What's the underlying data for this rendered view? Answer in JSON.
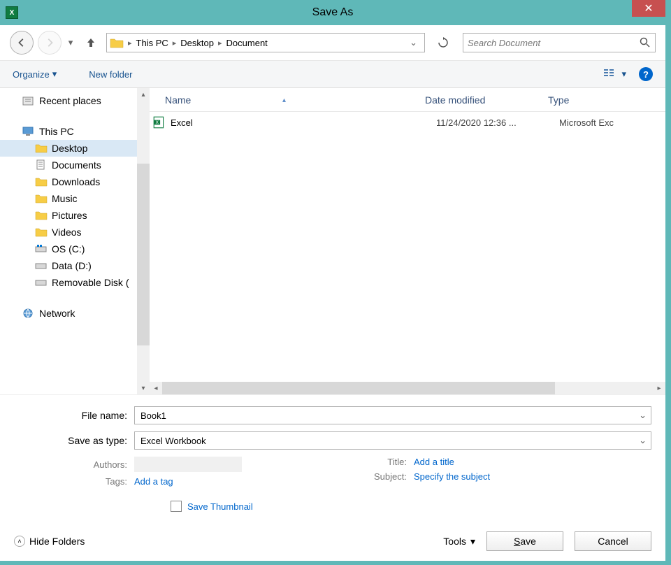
{
  "titlebar": {
    "title": "Save As"
  },
  "breadcrumb": {
    "seg1": "This PC",
    "seg2": "Desktop",
    "seg3": "Document"
  },
  "search": {
    "placeholder": "Search Document"
  },
  "toolbar": {
    "organize": "Organize",
    "new_folder": "New folder"
  },
  "tree": {
    "recent_places": "Recent places",
    "this_pc": "This PC",
    "desktop": "Desktop",
    "documents": "Documents",
    "downloads": "Downloads",
    "music": "Music",
    "pictures": "Pictures",
    "videos": "Videos",
    "os_c": "OS (C:)",
    "data_d": "Data (D:)",
    "removable": "Removable Disk (",
    "network": "Network"
  },
  "columns": {
    "name": "Name",
    "date": "Date modified",
    "type": "Type"
  },
  "files": [
    {
      "name": "Excel",
      "date": "11/24/2020 12:36 ...",
      "type": "Microsoft Exc"
    }
  ],
  "form": {
    "filename_label": "File name:",
    "filename_value": "Book1",
    "savetype_label": "Save as type:",
    "savetype_value": "Excel Workbook",
    "authors_label": "Authors:",
    "tags_label": "Tags:",
    "tags_value": "Add a tag",
    "title_label": "Title:",
    "title_value": "Add a title",
    "subject_label": "Subject:",
    "subject_value": "Specify the subject",
    "thumbnail_label": "Save Thumbnail"
  },
  "buttons": {
    "hide_folders": "Hide Folders",
    "tools": "Tools",
    "save": "Save",
    "save_ul": "S",
    "save_rest": "ave",
    "cancel": "Cancel"
  }
}
